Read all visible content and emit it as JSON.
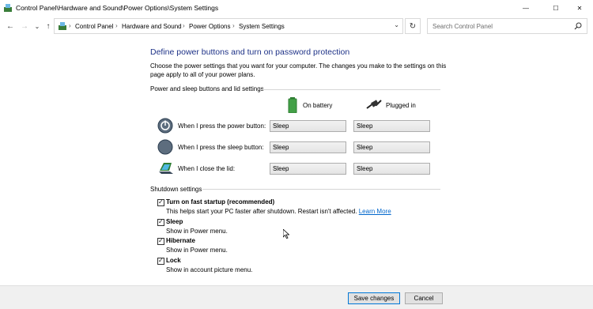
{
  "window": {
    "title": "Control Panel\\Hardware and Sound\\Power Options\\System Settings",
    "controls": {
      "minimize": "—",
      "maximize": "☐",
      "close": "✕"
    }
  },
  "nav": {
    "back": "←",
    "forward": "→",
    "recent": "⌄",
    "up": "↑",
    "breadcrumb": [
      "Control Panel",
      "Hardware and Sound",
      "Power Options",
      "System Settings"
    ],
    "separator": "›",
    "dropdown": "⌄",
    "refresh": "↻",
    "search_placeholder": "Search Control Panel"
  },
  "main": {
    "heading": "Define power buttons and turn on password protection",
    "description": "Choose the power settings that you want for your computer. The changes you make to the settings on this page apply to all of your power plans.",
    "power_section": {
      "title": "Power and sleep buttons and lid settings",
      "columns": [
        "On battery",
        "Plugged in"
      ],
      "rows": [
        {
          "label": "When I press the power button:",
          "on_battery": "Sleep",
          "plugged_in": "Sleep",
          "icon": "power-button-icon"
        },
        {
          "label": "When I press the sleep button:",
          "on_battery": "Sleep",
          "plugged_in": "Sleep",
          "icon": "sleep-button-icon"
        },
        {
          "label": "When I close the lid:",
          "on_battery": "Sleep",
          "plugged_in": "Sleep",
          "icon": "laptop-lid-icon"
        }
      ]
    },
    "shutdown_section": {
      "title": "Shutdown settings",
      "items": [
        {
          "label": "Turn on fast startup (recommended)",
          "description": "This helps start your PC faster after shutdown. Restart isn't affected.",
          "link": "Learn More",
          "checked": true
        },
        {
          "label": "Sleep",
          "description": "Show in Power menu.",
          "checked": true
        },
        {
          "label": "Hibernate",
          "description": "Show in Power menu.",
          "checked": true
        },
        {
          "label": "Lock",
          "description": "Show in account picture menu.",
          "checked": true
        }
      ]
    }
  },
  "footer": {
    "save_label": "Save changes",
    "cancel_label": "Cancel"
  },
  "colors": {
    "heading": "#1e3287",
    "link": "#0066cc",
    "accent": "#0078d7"
  }
}
